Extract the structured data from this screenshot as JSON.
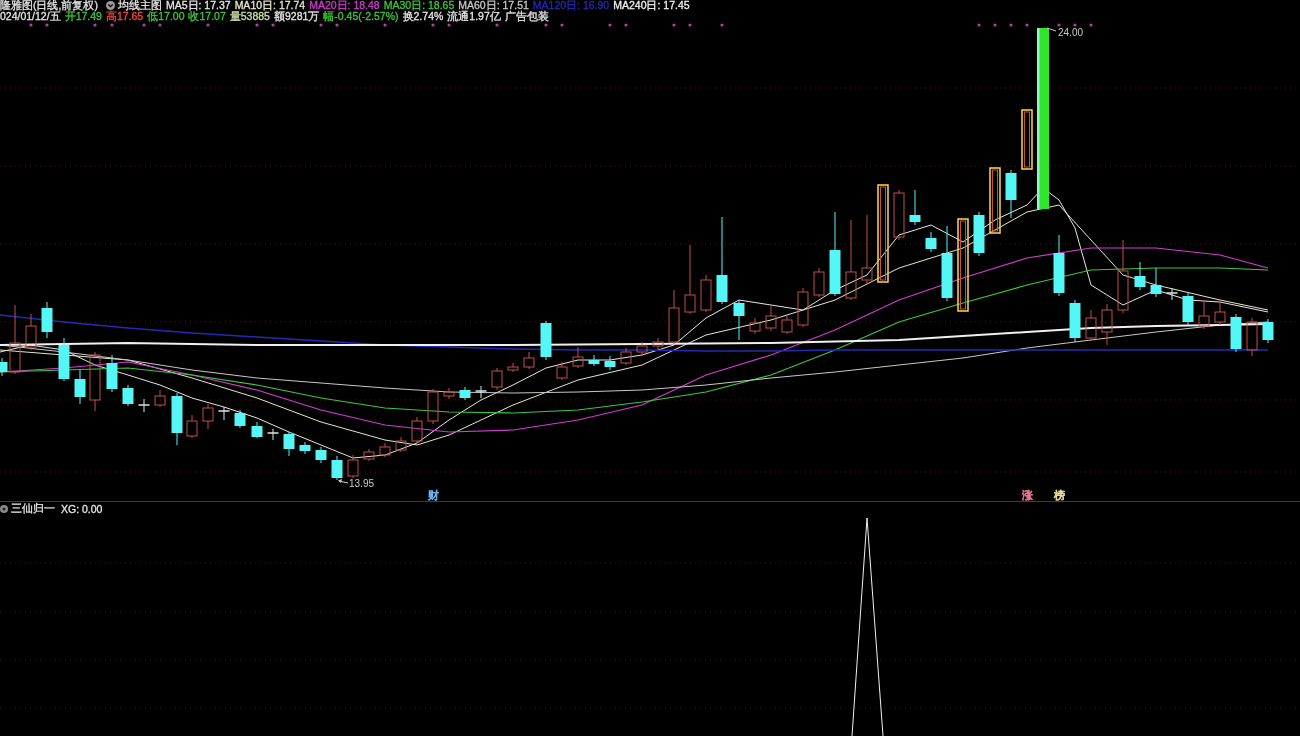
{
  "header": {
    "title": "隆雅图(日线,前复权)",
    "indicator": "均线主图",
    "moving_averages": [
      {
        "label": "MA5日: 17.37",
        "color": "#e6e6e6"
      },
      {
        "label": "MA10日: 17.74",
        "color": "#e6e6c8"
      },
      {
        "label": "MA20日: 18.48",
        "color": "#d23cd2"
      },
      {
        "label": "MA30日: 18.65",
        "color": "#3cc83c"
      },
      {
        "label": "MA60日: 17.51",
        "color": "#c8c8c8"
      },
      {
        "label": "MA120日: 16.90",
        "color": "#2828b4"
      },
      {
        "label": "MA240日: 17.45",
        "color": "#f0f0f0"
      }
    ]
  },
  "quote": [
    {
      "text": "024/01/12/五",
      "color": "#e6e6e6"
    },
    {
      "text": "开17.49",
      "color": "#3cc83c"
    },
    {
      "text": "高17.65",
      "color": "#ff4646"
    },
    {
      "text": "低17.00",
      "color": "#3cc83c"
    },
    {
      "text": "收17.07",
      "color": "#3cc83c"
    },
    {
      "text": "量53885",
      "color": "#c8e0a8"
    },
    {
      "text": "额9281万",
      "color": "#e6e6e6"
    },
    {
      "text": "幅-0.45(-2.57%)",
      "color": "#3cc83c"
    },
    {
      "text": "换2.74%",
      "color": "#e6e6e6"
    },
    {
      "text": "流通1.97亿",
      "color": "#e6e6e6"
    },
    {
      "text": "广告包装",
      "color": "#e6e6e6"
    }
  ],
  "main_chart": {
    "high_label": "24.00",
    "low_label": "13.95",
    "events": [
      {
        "label": "财",
        "color": "#6ab4f0"
      },
      {
        "label": "涨",
        "color": "#f07890"
      },
      {
        "label": "榜",
        "color": "#e6dca0"
      }
    ]
  },
  "sub_chart": {
    "title": "三仙归一",
    "reading": "XG: 0.00"
  }
}
